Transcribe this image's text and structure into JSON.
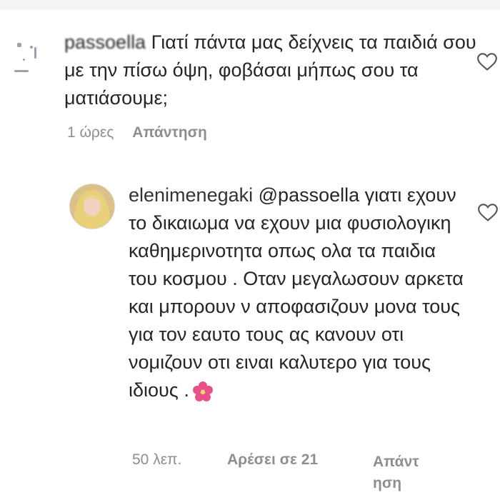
{
  "comment1": {
    "username": "passoella",
    "text": "Γιατί πάντα μας δείχνεις τα παιδιά σου με την πίσω όψη, φοβάσαι μήπως σου τα ματιάσουμε;",
    "time": "1 ώρες",
    "reply_label": "Απάντηση"
  },
  "comment2": {
    "username": "elenimenegaki",
    "mention": "@passoella",
    "text": "γιατι εχουν το δικαιωμα να εχουν μια φυσιολογικη καθημερινοτητα οπως ολα τα παιδια του κοσμου . Οταν μεγαλωσουν αρκετα και μπορουν ν αποφασιζουν μονα τους για τον εαυτο τους ας κανουν οτι νομιζουν οτι ειναι καλυτερο για τους ιδιους .",
    "emoji": "flower-emoji-icon",
    "time": "50 λεπ.",
    "likes": "Αρέσει σε 21",
    "reply_label_line1": "Απάντ",
    "reply_label_line2": "ηση"
  },
  "colors": {
    "text": "#262626",
    "meta": "#8e8e8e",
    "emoji": "#e8508a"
  }
}
